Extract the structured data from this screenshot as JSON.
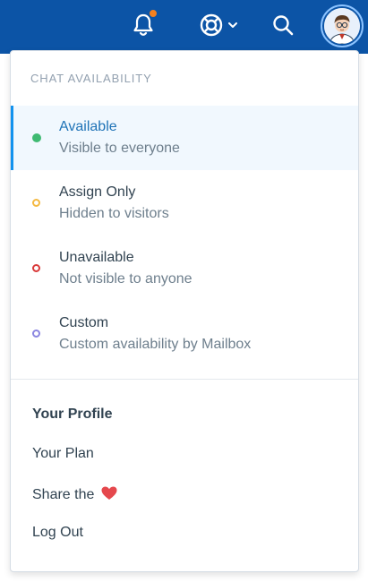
{
  "topbar": {
    "icons": [
      "bell-icon",
      "help-lifebuoy-icon",
      "chevron-down-icon",
      "search-icon",
      "avatar"
    ],
    "notification_color": "#f5811f",
    "background": "#0c54a6"
  },
  "dropdown": {
    "section_title": "CHAT AVAILABILITY",
    "statuses": [
      {
        "label": "Available",
        "description": "Visible to everyone",
        "color": "#3fba72",
        "selected": true
      },
      {
        "label": "Assign Only",
        "description": "Hidden to visitors",
        "color": "#f4b942",
        "selected": false
      },
      {
        "label": "Unavailable",
        "description": "Not visible to anyone",
        "color": "#d93a3a",
        "selected": false
      },
      {
        "label": "Custom",
        "description": "Custom availability by Mailbox",
        "color": "#8b86e0",
        "selected": false
      }
    ],
    "menu": {
      "profile": "Your Profile",
      "plan": "Your Plan",
      "share": "Share the",
      "logout": "Log Out"
    },
    "heart_color": "#e5484d"
  }
}
